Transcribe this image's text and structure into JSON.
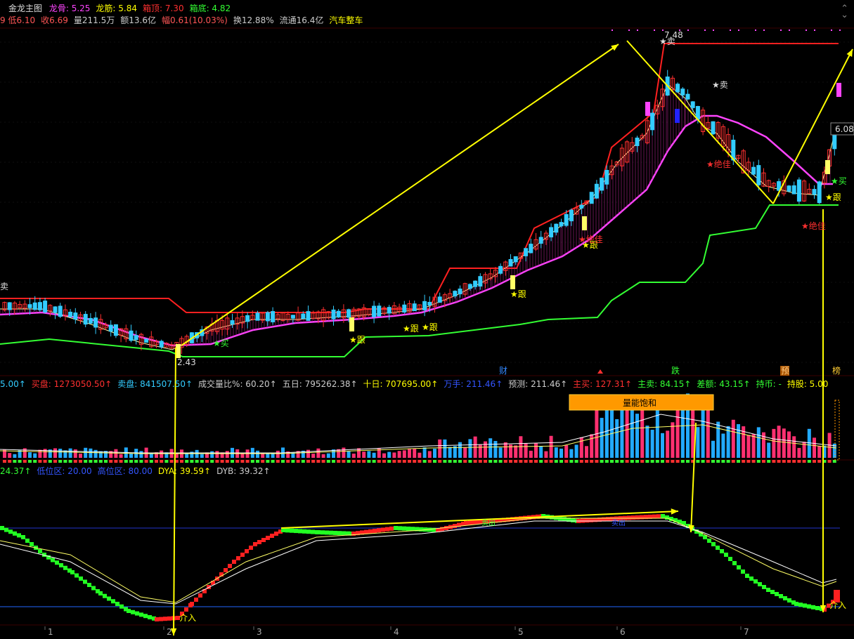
{
  "header": {
    "title": "金龙主图",
    "items": [
      {
        "label": "龙骨: 5.25",
        "color": "#ff44ff"
      },
      {
        "label": "龙筋: 5.84",
        "color": "#ffff00"
      },
      {
        "label": "箱顶: 7.30",
        "color": "#ff3030"
      },
      {
        "label": "箱底: 4.82",
        "color": "#33ff33"
      }
    ],
    "line2": [
      {
        "label": "9 低6.10",
        "color": "#ff5555"
      },
      {
        "label": "收6.69",
        "color": "#ff5555"
      },
      {
        "label": "量211.5万",
        "color": "#cccccc"
      },
      {
        "label": "额13.6亿",
        "color": "#cccccc"
      },
      {
        "label": "幅0.61(10.03%)",
        "color": "#ff5555"
      },
      {
        "label": "换12.88%",
        "color": "#cccccc"
      },
      {
        "label": "流通16.4亿",
        "color": "#cccccc"
      },
      {
        "label": "汽车整车",
        "color": "#ffff00"
      }
    ]
  },
  "volume_header": [
    {
      "label": "5.00↑",
      "color": "#33ccff"
    },
    {
      "label": "买盘: 1273050.50↑",
      "color": "#ff3030"
    },
    {
      "label": "卖盘: 841507.50↑",
      "color": "#33ccff"
    },
    {
      "label": "成交量比%: 60.20↑",
      "color": "#cccccc"
    },
    {
      "label": "五日: 795262.38↑",
      "color": "#cccccc"
    },
    {
      "label": "十日: 707695.00↑",
      "color": "#ffff00"
    },
    {
      "label": "万手: 211.46↑",
      "color": "#3355ff"
    },
    {
      "label": "预测: 211.46↑",
      "color": "#cccccc"
    },
    {
      "label": "主买: 127.31↑",
      "color": "#ff3030"
    },
    {
      "label": "主卖: 84.15↑",
      "color": "#33ff33"
    },
    {
      "label": "差额: 43.15↑",
      "color": "#33ff33"
    },
    {
      "label": "持币: -",
      "color": "#33ff33"
    },
    {
      "label": "持股: 5.00",
      "color": "#ffff00"
    }
  ],
  "osc_header": [
    {
      "label": "24.37↑",
      "color": "#33ff33"
    },
    {
      "label": "低位区: 20.00",
      "color": "#3355ff"
    },
    {
      "label": "高位区: 80.00",
      "color": "#3355ff"
    },
    {
      "label": "DYA: 39.59↑",
      "color": "#ffff00"
    },
    {
      "label": "DYB: 39.32↑",
      "color": "#cccccc"
    }
  ],
  "annotations": {
    "price_high": "7.48",
    "price_low": "2.43",
    "price_last": "6.08",
    "sell_left": "卖",
    "sell_top": "★卖",
    "star_sell_peak": "★卖",
    "follow": "★跟",
    "buy": "★买",
    "absolute_bottom": "★绝佳",
    "cai": "财",
    "die": "跌",
    "yu": "预",
    "bang": "榜",
    "vol_banner": "量能饱和",
    "osc_buy": "介入",
    "sell_green_1": "卖出",
    "sell_green_2": "卖出"
  },
  "x_axis_ticks": [
    "1",
    "2",
    "3",
    "4",
    "5",
    "6",
    "7"
  ],
  "colors": {
    "up": "#ff3030",
    "down": "#33ccff",
    "box_top": "#ff2020",
    "box_bottom": "#33ff33",
    "long_line": "#ff44ff",
    "arrow": "#ffff00"
  },
  "chart_data": [
    {
      "type": "candlestick",
      "title": "金龙主图",
      "annotated_values": {
        "high": 7.48,
        "low": 2.43,
        "last": 6.08,
        "close": 6.69,
        "day_low": 6.1
      },
      "indicators": {
        "龙骨": 5.25,
        "龙筋": 5.84,
        "箱顶": 7.3,
        "箱底": 4.82
      },
      "x_ticks": [
        "1",
        "2",
        "3",
        "4",
        "5",
        "6",
        "7"
      ]
    },
    {
      "type": "bar",
      "title": "成交量",
      "values": {
        "买盘": 1273050.5,
        "卖盘": 841507.5,
        "成交量比%": 60.2,
        "五日": 795262.38,
        "十日": 707695.0,
        "万手": 211.46,
        "预测": 211.46,
        "主买": 127.31,
        "主卖": 84.15,
        "差额": 43.15
      }
    },
    {
      "type": "line",
      "title": "",
      "values": {
        "低位区": 20.0,
        "高位区": 80.0,
        "DYA": 39.59,
        "DYB": 39.32
      },
      "ylim": [
        0,
        100
      ]
    }
  ]
}
